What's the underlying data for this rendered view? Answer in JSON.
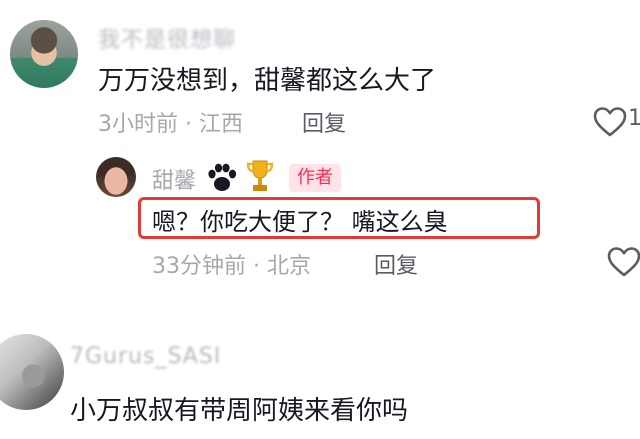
{
  "comments": [
    {
      "username": "我不是很想聊",
      "text": "万万没想到，甜馨都这么大了",
      "time": "3小时前",
      "location": "江西",
      "reply_label": "回复",
      "like_count": "1",
      "avatar_icon": "user-avatar"
    },
    {
      "username": "甜馨",
      "badges": [
        "paw-icon",
        "trophy-icon"
      ],
      "author_badge": "作者",
      "text": "嗯？你吃大便了？ 嘴这么臭",
      "time": "33分钟前",
      "location": "北京",
      "reply_label": "回复",
      "highlight_color": "#e53935",
      "avatar_icon": "user-avatar"
    },
    {
      "username": "7Gurus_SASI",
      "text": "小万叔叔有带周阿姨来看你吗",
      "avatar_icon": "user-avatar"
    }
  ],
  "meta_separator": " · ",
  "colors": {
    "primary_text": "#161823",
    "secondary_text": "#a6a8ae",
    "accent": "#fe2c55",
    "author_badge_bg": "#ffe3e8"
  }
}
